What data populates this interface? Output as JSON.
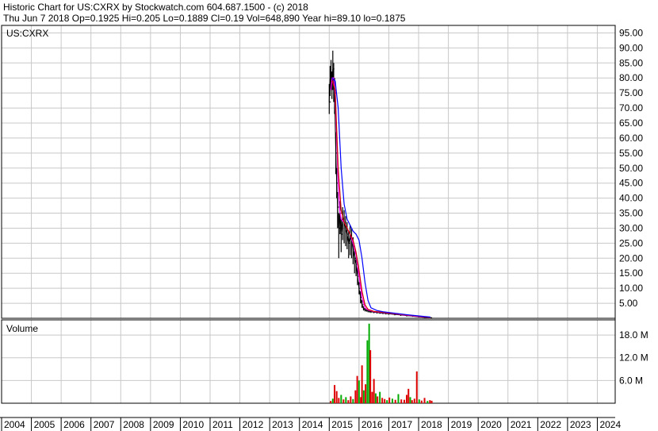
{
  "header": {
    "line1": "Historic Chart for US:CXRX by Stockwatch.com 604.687.1500 - (c) 2018",
    "line2": "Thu Jun  7 2018   Op=0.1925   Hi=0.205   Lo=0.1889   Cl=0.19   Vol=648,890   Year hi=89.10   lo=0.1875"
  },
  "colors": {
    "grid": "#c8c8c8",
    "frame": "#000000",
    "price": "#000000",
    "ma_short": "#ff00ff",
    "ma_mid": "#cc0000",
    "ma_long": "#0000ff",
    "volume_up": "#00aa00",
    "volume_down": "#dd0000"
  },
  "chart_data": [
    {
      "type": "line",
      "title": "US:CXRX",
      "ylim": [
        0,
        97.5
      ],
      "y_ticks": [
        "95.00",
        "90.00",
        "85.00",
        "80.00",
        "75.00",
        "70.00",
        "65.00",
        "60.00",
        "55.00",
        "50.00",
        "45.00",
        "40.00",
        "35.00",
        "30.00",
        "25.00",
        "20.00",
        "15.00",
        "10.00",
        "5.00"
      ],
      "x_range": [
        2004,
        2024.6
      ],
      "x_ticks": [
        "2004",
        "2005",
        "2006",
        "2007",
        "2008",
        "2009",
        "2010",
        "2011",
        "2012",
        "2013",
        "2014",
        "2015",
        "2016",
        "2017",
        "2018",
        "2019",
        "2020",
        "2021",
        "2022",
        "2023",
        "2024"
      ],
      "grid": true,
      "series": [
        {
          "kind": "price",
          "x": [
            2015.0,
            2015.03,
            2015.06,
            2015.09,
            2015.12,
            2015.15,
            2015.18,
            2015.22,
            2015.25,
            2015.28,
            2015.32,
            2015.36,
            2015.4,
            2015.45,
            2015.5,
            2015.55,
            2015.6,
            2015.65,
            2015.7,
            2015.75,
            2015.8,
            2015.85,
            2015.9,
            2015.95,
            2016.0,
            2016.05,
            2016.1,
            2016.15,
            2016.2,
            2016.25,
            2016.3,
            2016.35,
            2016.4,
            2016.5,
            2016.6,
            2016.7,
            2016.8,
            2016.9,
            2017.0,
            2017.2,
            2017.4,
            2017.6,
            2017.8,
            2018.0,
            2018.2,
            2018.4
          ],
          "y": [
            72,
            80,
            82,
            78,
            83,
            79,
            75,
            55,
            45,
            37,
            30,
            35,
            28,
            33,
            32,
            30,
            28,
            25,
            27,
            26,
            23,
            20,
            18,
            14,
            10,
            7,
            4.5,
            3.2,
            2.8,
            2.6,
            2.4,
            2.3,
            2.2,
            2.0,
            1.9,
            1.8,
            1.7,
            1.6,
            1.5,
            1.3,
            1.1,
            0.9,
            0.7,
            0.5,
            0.3,
            0.2
          ],
          "high": [
            78,
            84,
            86,
            82,
            89.1,
            85,
            80,
            62,
            50,
            42,
            35,
            39,
            33,
            37,
            36,
            34,
            32,
            29,
            31,
            30,
            27,
            24,
            21,
            17,
            12,
            9,
            6,
            4,
            3.4,
            3.1,
            2.8,
            2.6,
            2.5,
            2.3,
            2.2,
            2.0,
            1.9,
            1.8,
            1.7,
            1.5,
            1.3,
            1.1,
            0.9,
            0.7,
            0.4,
            0.25
          ],
          "low": [
            68,
            74,
            77,
            73,
            76,
            72,
            68,
            48,
            40,
            30,
            20,
            28,
            22,
            26,
            25,
            24,
            23,
            20,
            21,
            20,
            18,
            15,
            14,
            11,
            8,
            5,
            3.5,
            2.6,
            2.3,
            2.2,
            2.0,
            1.9,
            1.8,
            1.7,
            1.6,
            1.5,
            1.4,
            1.3,
            1.2,
            1.0,
            0.8,
            0.6,
            0.5,
            0.3,
            0.2,
            0.19
          ]
        },
        {
          "kind": "ma_short",
          "x": [
            2015.05,
            2015.1,
            2015.15,
            2015.2,
            2015.25,
            2015.3,
            2015.35,
            2015.4,
            2015.5,
            2015.6,
            2015.7,
            2015.8,
            2015.9,
            2016.0,
            2016.1,
            2016.2,
            2016.3,
            2016.5,
            2016.8,
            2017.2,
            2017.6,
            2018.0,
            2018.4
          ],
          "y": [
            76,
            80,
            80,
            74,
            60,
            45,
            36,
            33,
            32,
            30,
            28,
            25,
            21,
            14,
            7,
            3.5,
            2.8,
            2.2,
            1.9,
            1.5,
            1.0,
            0.6,
            0.25
          ]
        },
        {
          "kind": "ma_mid",
          "x": [
            2015.1,
            2015.2,
            2015.3,
            2015.4,
            2015.5,
            2015.6,
            2015.7,
            2015.8,
            2015.9,
            2016.0,
            2016.1,
            2016.2,
            2016.3,
            2016.5,
            2016.8,
            2017.2,
            2017.6,
            2018.0,
            2018.4
          ],
          "y": [
            79,
            76,
            50,
            36,
            32,
            30,
            28,
            26,
            22,
            16,
            9,
            4.5,
            3.0,
            2.3,
            2.0,
            1.6,
            1.1,
            0.7,
            0.3
          ]
        },
        {
          "kind": "ma_long",
          "x": [
            2015.1,
            2015.2,
            2015.3,
            2015.4,
            2015.5,
            2015.6,
            2015.7,
            2015.8,
            2015.9,
            2016.0,
            2016.1,
            2016.2,
            2016.3,
            2016.4,
            2016.6,
            2016.8,
            2017.2,
            2017.6,
            2018.0,
            2018.4
          ],
          "y": [
            80,
            79,
            70,
            50,
            38,
            33,
            31,
            29,
            28,
            26,
            20,
            12,
            6,
            3.5,
            2.6,
            2.2,
            1.7,
            1.2,
            0.8,
            0.4
          ]
        }
      ]
    },
    {
      "type": "bar",
      "title": "Volume",
      "ylim": [
        0,
        22
      ],
      "y_ticks": [
        "18.0 M",
        "12.0 M",
        "6.0 M"
      ],
      "bars": [
        {
          "x": 2015.05,
          "v": 0.6,
          "up": false
        },
        {
          "x": 2015.12,
          "v": 1.2,
          "up": true
        },
        {
          "x": 2015.18,
          "v": 4.8,
          "up": false
        },
        {
          "x": 2015.25,
          "v": 3.2,
          "up": false
        },
        {
          "x": 2015.32,
          "v": 1.4,
          "up": false
        },
        {
          "x": 2015.4,
          "v": 2.2,
          "up": true
        },
        {
          "x": 2015.48,
          "v": 1.0,
          "up": false
        },
        {
          "x": 2015.56,
          "v": 1.6,
          "up": true
        },
        {
          "x": 2015.64,
          "v": 0.8,
          "up": false
        },
        {
          "x": 2015.72,
          "v": 1.8,
          "up": false
        },
        {
          "x": 2015.8,
          "v": 1.1,
          "up": true
        },
        {
          "x": 2015.88,
          "v": 3.4,
          "up": false
        },
        {
          "x": 2015.94,
          "v": 7.2,
          "up": false
        },
        {
          "x": 2016.0,
          "v": 6.0,
          "up": true
        },
        {
          "x": 2016.06,
          "v": 1.6,
          "up": false
        },
        {
          "x": 2016.1,
          "v": 10.0,
          "up": false
        },
        {
          "x": 2016.16,
          "v": 3.4,
          "up": true
        },
        {
          "x": 2016.22,
          "v": 5.0,
          "up": false
        },
        {
          "x": 2016.28,
          "v": 16.6,
          "up": true
        },
        {
          "x": 2016.34,
          "v": 21.0,
          "up": true
        },
        {
          "x": 2016.38,
          "v": 14.0,
          "up": false
        },
        {
          "x": 2016.44,
          "v": 3.0,
          "up": false
        },
        {
          "x": 2016.5,
          "v": 6.4,
          "up": false
        },
        {
          "x": 2016.56,
          "v": 2.6,
          "up": true
        },
        {
          "x": 2016.62,
          "v": 1.8,
          "up": false
        },
        {
          "x": 2016.7,
          "v": 3.0,
          "up": true
        },
        {
          "x": 2016.78,
          "v": 1.4,
          "up": false
        },
        {
          "x": 2016.86,
          "v": 1.1,
          "up": false
        },
        {
          "x": 2016.94,
          "v": 0.8,
          "up": true
        },
        {
          "x": 2017.02,
          "v": 1.5,
          "up": false
        },
        {
          "x": 2017.12,
          "v": 1.2,
          "up": true
        },
        {
          "x": 2017.22,
          "v": 0.9,
          "up": false
        },
        {
          "x": 2017.32,
          "v": 2.4,
          "up": true
        },
        {
          "x": 2017.42,
          "v": 1.0,
          "up": false
        },
        {
          "x": 2017.52,
          "v": 0.9,
          "up": false
        },
        {
          "x": 2017.6,
          "v": 2.2,
          "up": false
        },
        {
          "x": 2017.66,
          "v": 3.8,
          "up": false
        },
        {
          "x": 2017.72,
          "v": 1.6,
          "up": true
        },
        {
          "x": 2017.78,
          "v": 0.8,
          "up": false
        },
        {
          "x": 2017.86,
          "v": 1.2,
          "up": false
        },
        {
          "x": 2017.94,
          "v": 8.4,
          "up": false
        },
        {
          "x": 2018.02,
          "v": 1.0,
          "up": true
        },
        {
          "x": 2018.1,
          "v": 0.7,
          "up": false
        },
        {
          "x": 2018.2,
          "v": 1.4,
          "up": false
        },
        {
          "x": 2018.3,
          "v": 0.6,
          "up": true
        },
        {
          "x": 2018.38,
          "v": 0.8,
          "up": false
        },
        {
          "x": 2018.44,
          "v": 0.65,
          "up": false
        }
      ]
    }
  ]
}
